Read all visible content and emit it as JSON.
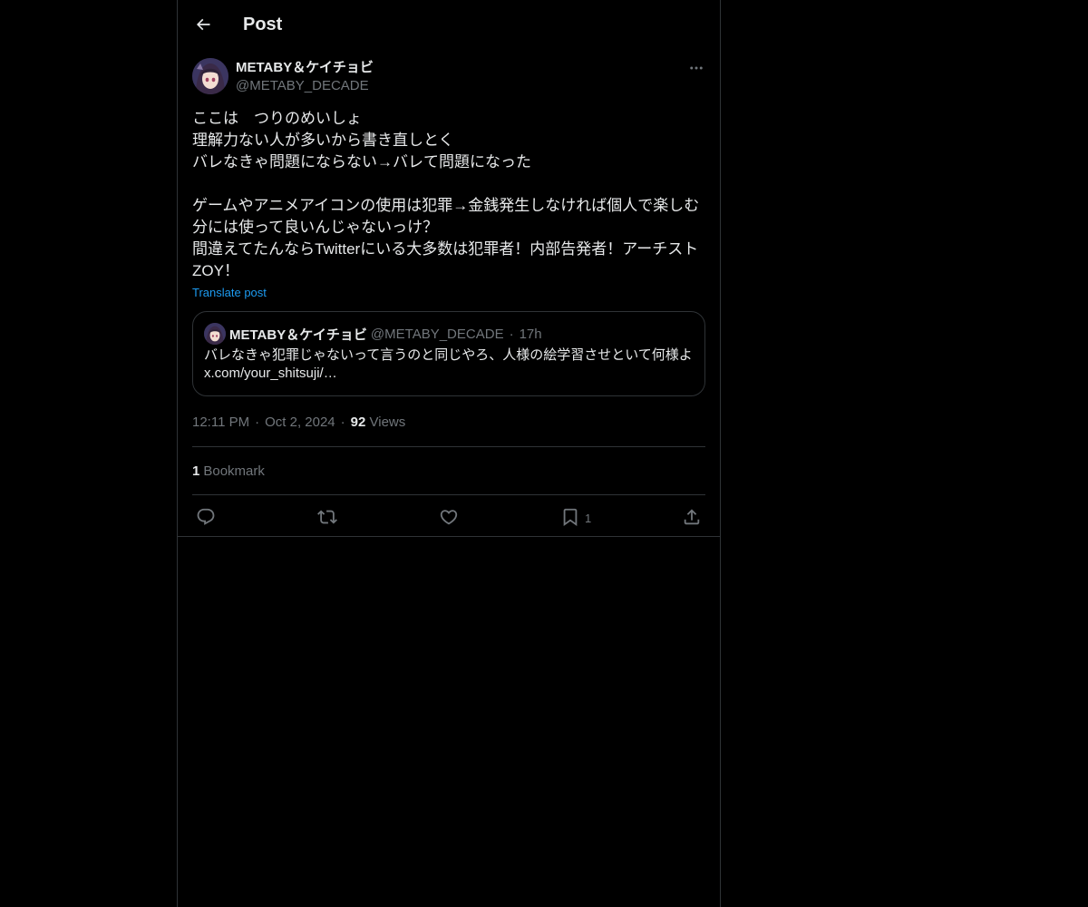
{
  "header": {
    "title": "Post"
  },
  "post": {
    "author_name": "METABY＆ケイチョビ",
    "author_handle": "@METABY_DECADE",
    "text": "ここは　つりのめいしょ\n理解力ない人が多いから書き直しとく\nバレなきゃ問題にならない→バレて問題になった\n\nゲームやアニメアイコンの使用は犯罪→金銭発生しなければ個人で楽しむ分には使って良いんじゃないっけ？\n間違えてたんならTwitterにいる大多数は犯罪者！内部告発者！アーチストZOY！",
    "translate_label": "Translate post",
    "quote": {
      "author_name": "METABY＆ケイチョビ",
      "author_handle": "@METABY_DECADE",
      "separator": "·",
      "time": "17h",
      "text": "バレなきゃ犯罪じゃないって言うのと同じやろ、人様の絵学習させといて何様よ\nx.com/your_shitsuji/…"
    },
    "meta": {
      "time": "12:11 PM",
      "separator": "·",
      "date": "Oct 2, 2024",
      "views_count": "92",
      "views_label": "Views"
    },
    "bookmarks": {
      "count": "1",
      "label": "Bookmark"
    },
    "actions": {
      "bookmark_count": "1"
    }
  },
  "colors": {
    "background": "#000000",
    "text": "#e7e9ea",
    "secondary": "#71767b",
    "accent": "#1d9bf0",
    "border": "#2f3336"
  },
  "icons": [
    "back-arrow-icon",
    "more-icon",
    "reply-icon",
    "repost-icon",
    "like-icon",
    "bookmark-icon",
    "share-icon"
  ]
}
